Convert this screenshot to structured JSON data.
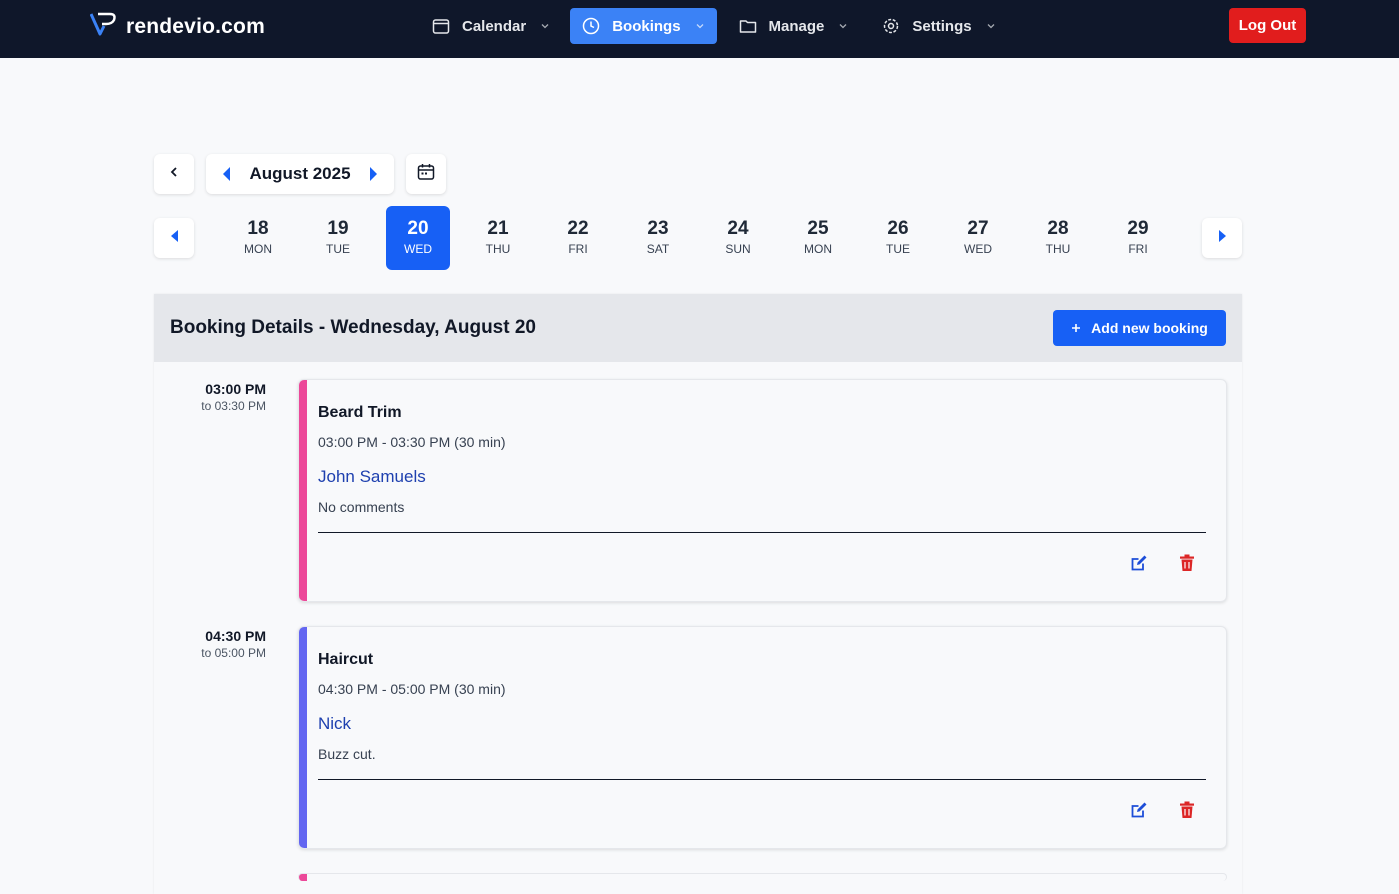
{
  "brand": {
    "name": "rendevio.com"
  },
  "nav": {
    "items": [
      {
        "label": "Calendar",
        "icon": "calendar-icon",
        "active": false
      },
      {
        "label": "Bookings",
        "icon": "clock-icon",
        "active": true
      },
      {
        "label": "Manage",
        "icon": "folder-icon",
        "active": false
      },
      {
        "label": "Settings",
        "icon": "gear-icon",
        "active": false
      }
    ],
    "logout_label": "Log Out"
  },
  "month_nav": {
    "label": "August 2025"
  },
  "days": [
    {
      "num": "18",
      "dow": "MON"
    },
    {
      "num": "19",
      "dow": "TUE"
    },
    {
      "num": "20",
      "dow": "WED",
      "selected": true
    },
    {
      "num": "21",
      "dow": "THU"
    },
    {
      "num": "22",
      "dow": "FRI"
    },
    {
      "num": "23",
      "dow": "SAT"
    },
    {
      "num": "24",
      "dow": "SUN"
    },
    {
      "num": "25",
      "dow": "MON"
    },
    {
      "num": "26",
      "dow": "TUE"
    },
    {
      "num": "27",
      "dow": "WED"
    },
    {
      "num": "28",
      "dow": "THU"
    },
    {
      "num": "29",
      "dow": "FRI"
    }
  ],
  "panel": {
    "title": "Booking Details - Wednesday, August 20",
    "add_label": "Add new booking"
  },
  "bookings": [
    {
      "start": "03:00 PM",
      "end_label": "to 03:30 PM",
      "service": "Beard Trim",
      "range": "03:00 PM - 03:30 PM (30 min)",
      "client": "John Samuels",
      "comment": "No comments",
      "color": "#ec4899"
    },
    {
      "start": "04:30 PM",
      "end_label": "to 05:00 PM",
      "service": "Haircut",
      "range": "04:30 PM - 05:00 PM (30 min)",
      "client": "Nick",
      "comment": "Buzz cut.",
      "color": "#6366f1"
    }
  ],
  "colors": {
    "nav_bg": "#0f172a",
    "accent": "#1760f5",
    "danger": "#e11d1d",
    "edit": "#1d4ed8",
    "delete": "#dc2626"
  }
}
